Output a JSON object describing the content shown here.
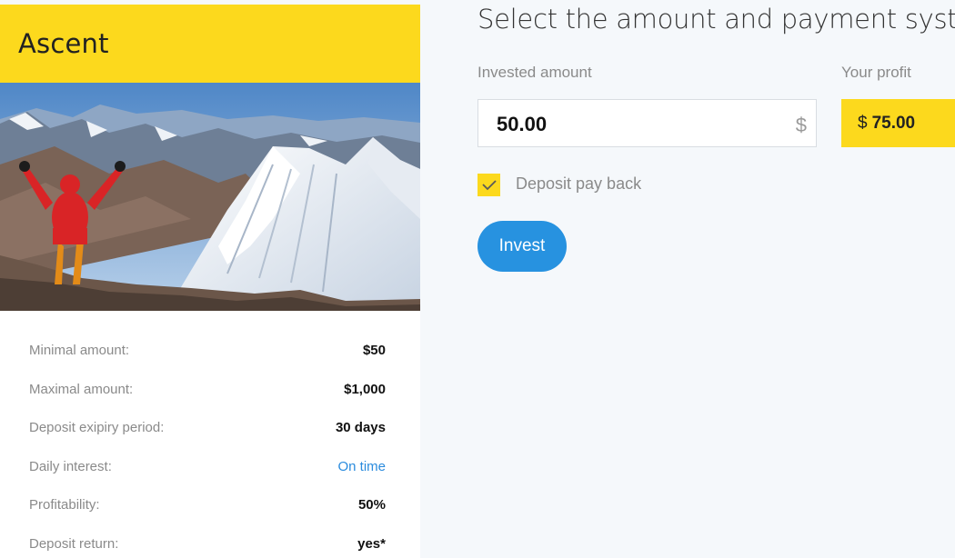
{
  "plan": {
    "title": "Ascent",
    "details": [
      {
        "label": "Minimal amount:",
        "value": "$50"
      },
      {
        "label": "Maximal amount:",
        "value": "$1,000"
      },
      {
        "label": "Deposit exipiry period:",
        "value": "30 days"
      },
      {
        "label": "Daily interest:",
        "value": "On time"
      },
      {
        "label": "Profitability:",
        "value": "50%"
      },
      {
        "label": "Deposit return:",
        "value": "yes*"
      }
    ]
  },
  "form": {
    "title": "Select the amount and payment system",
    "invested_label": "Invested amount",
    "invested_value": "50.00",
    "currency_sign": "$",
    "profit_label": "Your profit",
    "profit_prefix": "$",
    "profit_value": "75.00",
    "payback_label": "Deposit pay back",
    "payback_checked": true,
    "invest_label": "Invest"
  },
  "colors": {
    "accent_yellow": "#fcd91d",
    "button_blue": "#2792e0",
    "link_blue": "#2a8bdd"
  },
  "icons": {
    "checkbox": "check-icon"
  }
}
